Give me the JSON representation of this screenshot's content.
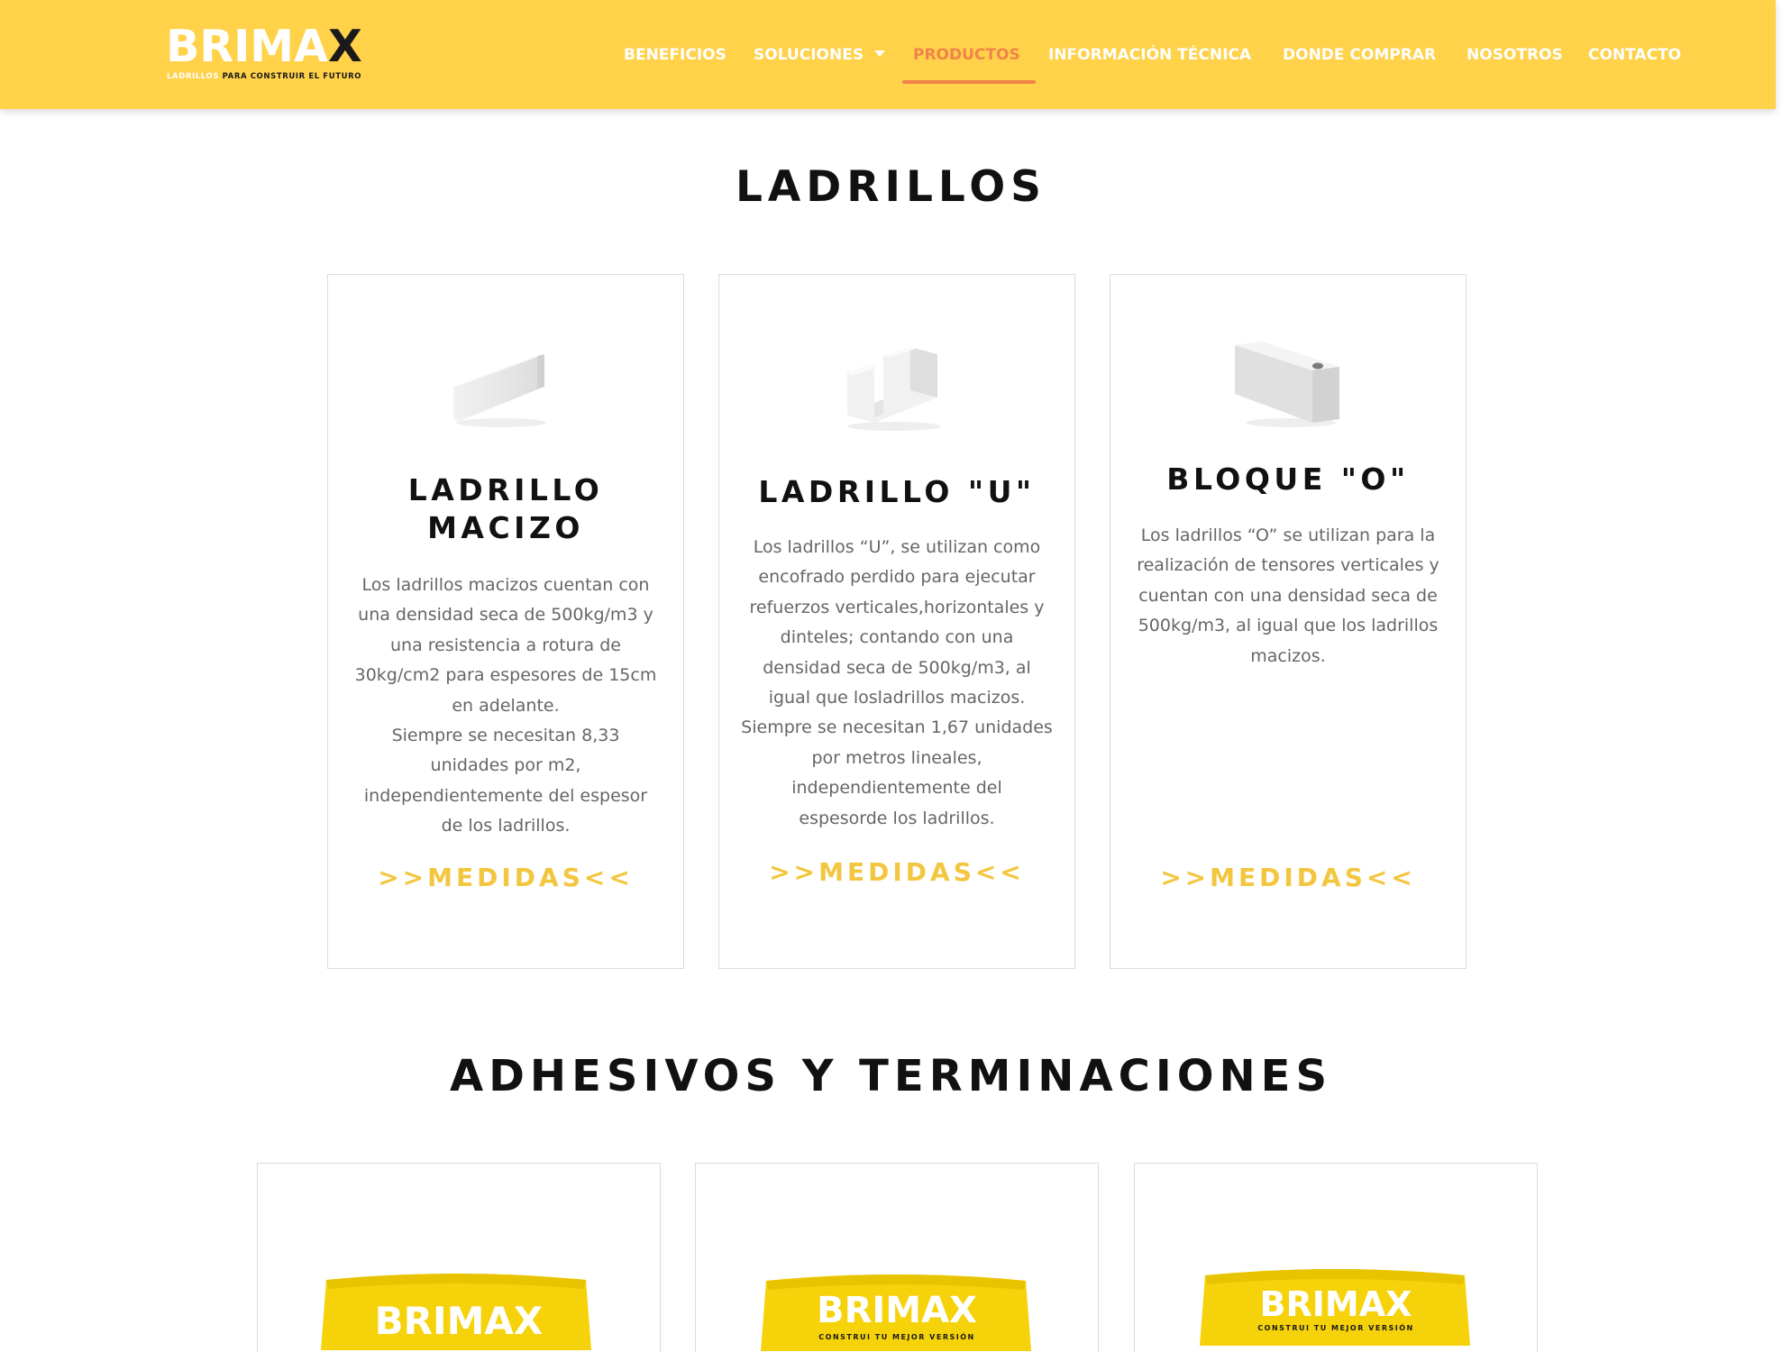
{
  "brand": {
    "name_main": "BRIMA",
    "name_x": "X",
    "tagline_prefix": "LADRILLOS",
    "tagline_rest": " PARA CONSTRUIR EL FUTURO"
  },
  "nav": {
    "items": [
      {
        "label": "BENEFICIOS"
      },
      {
        "label": "SOLUCIONES"
      },
      {
        "label": "PRODUCTOS"
      },
      {
        "label": "INFORMACIÓN TÉCNICA"
      },
      {
        "label": "DONDE COMPRAR"
      },
      {
        "label": "NOSOTROS"
      },
      {
        "label": "CONTACTO"
      }
    ],
    "active": "PRODUCTOS",
    "colors": {
      "bar": "#ffd24a",
      "active": "#f0834a",
      "text": "#ffffff"
    }
  },
  "sections": {
    "ladrillos": {
      "title": "LADRILLOS",
      "cards": [
        {
          "title_line1": "LADRILLO",
          "title_line2": "MACIZO",
          "desc": [
            "Los ladrillos macizos cuentan con",
            "una densidad seca de 500kg/m3 y",
            "una resistencia a rotura de",
            "30kg/cm2 para espesores de 15cm",
            "en adelante.",
            "Siempre se necesitan 8,33",
            "unidades por m2,",
            "independientemente del espesor",
            "de los ladrillos."
          ],
          "link": ">>MEDIDAS<<"
        },
        {
          "title_line1": "LADRILLO \"U\"",
          "desc": [
            "Los ladrillos “U”, se utilizan como",
            "encofrado perdido para ejecutar",
            "refuerzos verticales,horizontales y",
            "dinteles; contando con una",
            "densidad seca de 500kg/m3, al",
            "igual que losladrillos macizos.",
            "Siempre se necesitan 1,67 unidades",
            "por metros lineales,",
            "independientemente del",
            "espesorde los ladrillos."
          ],
          "link": ">>MEDIDAS<<"
        },
        {
          "title_line1": "BLOQUE \"O\"",
          "desc": [
            "Los ladrillos “O” se utilizan para la",
            "realización de tensores verticales y",
            "cuentan con una densidad seca de",
            "500kg/m3, al igual que los ladrillos",
            "macizos."
          ],
          "link": ">>MEDIDAS<<"
        }
      ]
    },
    "adhesivos": {
      "title": "ADHESIVOS Y TERMINACIONES",
      "bags": [
        {
          "brand": "BRIMAX"
        },
        {
          "brand": "BRIMAX",
          "tagline": "CONSTRUI TU MEJOR VERSIÓN"
        },
        {
          "brand": "BRIMAX",
          "tagline": "CONSTRUI TU MEJOR VERSIÓN"
        }
      ]
    }
  },
  "accent_color": "#f3c63f"
}
